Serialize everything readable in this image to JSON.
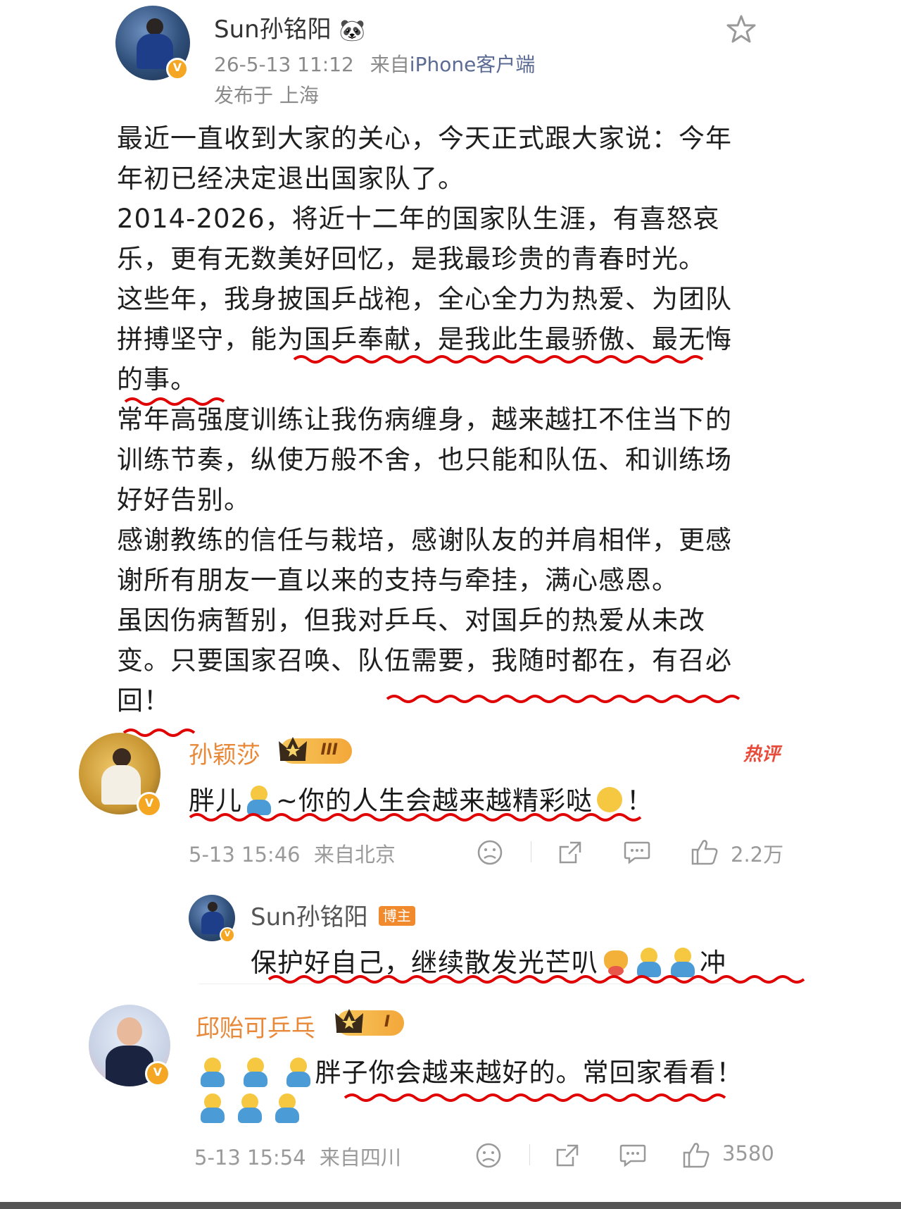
{
  "post": {
    "author": "Sun孙铭阳",
    "author_emoji": "🐼",
    "timestamp": "26-5-13 11:12",
    "source_prefix": "来自",
    "source": "iPhone客户端",
    "location": "发布于 上海",
    "paragraphs": [
      "最近一直收到大家的关心，今天正式跟大家说：今年年初已经决定退出国家队了。",
      "2014-2026，将近十二年的国家队生涯，有喜怒哀乐，更有无数美好回忆，是我最珍贵的青春时光。",
      "这些年，我身披国乒战袍，全心全力为热爱、为团队拼搏坚守，能为国乒奉献，是我此生最骄傲、最无悔的事。",
      "常年高强度训练让我伤病缠身，越来越扛不住当下的训练节奏，纵使万般不舍，也只能和队伍、和训练场好好告别。",
      "感谢教练的信任与栽培，感谢队友的并肩相伴，更感谢所有朋友一直以来的支持与牵挂，满心感恩。",
      "虽因伤病暂别，但我对乒乓、对国乒的热爱从未改变。只要国家召唤、队伍需要，我随时都在，有召必回！"
    ]
  },
  "comments": [
    {
      "name": "孙颖莎",
      "level": "III",
      "hot_label": "热评",
      "text_a": "胖儿",
      "text_b": "~你的人生会越来越精彩哒",
      "text_c": "！",
      "time": "5-13 15:46",
      "location": "来自北京",
      "likes": "2.2万",
      "reply": {
        "name": "Sun孙铭阳",
        "role": "博主",
        "text_a": "保护好自己，继续散发光芒叭",
        "text_b": "冲"
      }
    },
    {
      "name": "邱贻可乒乓",
      "level": "I",
      "text": "胖子你会越来越好的。常回家看看！",
      "time": "5-13 15:54",
      "location": "来自四川",
      "likes": "3580"
    }
  ],
  "icons": [
    "star-icon",
    "dislike-icon",
    "share-icon",
    "comment-icon",
    "thumbs-up-icon",
    "verified-badge-icon",
    "crown-icon"
  ],
  "colors": {
    "accent_orange": "#e8893a",
    "underline_red": "#e00000",
    "source_blue": "#5b6b93"
  }
}
